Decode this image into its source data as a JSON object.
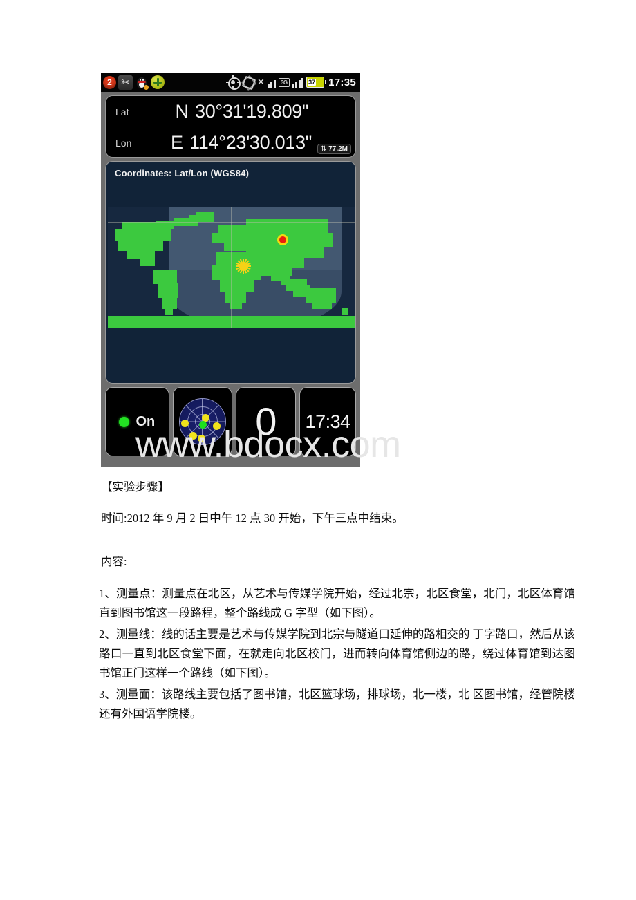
{
  "phone": {
    "statusbar": {
      "notification_count": "2",
      "icons": [
        "notification-badge",
        "scissors-icon",
        "qq-penguin-icon",
        "green-plus-icon",
        "gps-target-icon",
        "sync-icon",
        "signal-bars-icon",
        "3g-icon",
        "signal-strength-icon",
        "battery-icon"
      ],
      "network_label": "3G",
      "battery_level": "37",
      "clock": "17:35"
    },
    "coordinates_panel": {
      "lat_label": "Lat",
      "lat_hemisphere": "N",
      "lat_value": "30°31'19.809\"",
      "lon_label": "Lon",
      "lon_hemisphere": "E",
      "lon_value": "114°23'30.013\"",
      "data_overlay_arrows": "⇅",
      "data_overlay_amount": "77.2M"
    },
    "map_panel": {
      "title": "Coordinates: Lat/Lon (WGS84)",
      "marker_name": "current-position-marker",
      "sun_name": "sun-position-icon"
    },
    "bottom_row": {
      "gps_status": "On",
      "satellite_widget": "satellite-radar",
      "satellite_count": "0",
      "fix_time": "17:34"
    }
  },
  "watermark": "www.bdocx.com",
  "document": {
    "heading": "【实验步骤】",
    "time_line": "时间:2012 年 9 月 2 日中午 12 点 30 开始，下午三点中结束。",
    "content_label": "内容:",
    "paragraphs": [
      "1、测量点：测量点在北区，从艺术与传媒学院开始，经过北宗，北区食堂，北门，北区体育馆直到图书馆这一段路程，整个路线成 G 字型（如下图）。",
      "2、测量线：线的话主要是艺术与传媒学院到北宗与隧道口延伸的路相交的 丁字路口，然后从该路口一直到北区食堂下面，在就走向北区校门，进而转向体育馆侧边的路，绕过体育馆到达图书馆正门这样一个路线（如下图）。",
      "3、测量面：该路线主要包括了图书馆，北区篮球场，排球场，北一楼，北 区图书馆，经管院楼还有外国语学院楼。"
    ]
  }
}
